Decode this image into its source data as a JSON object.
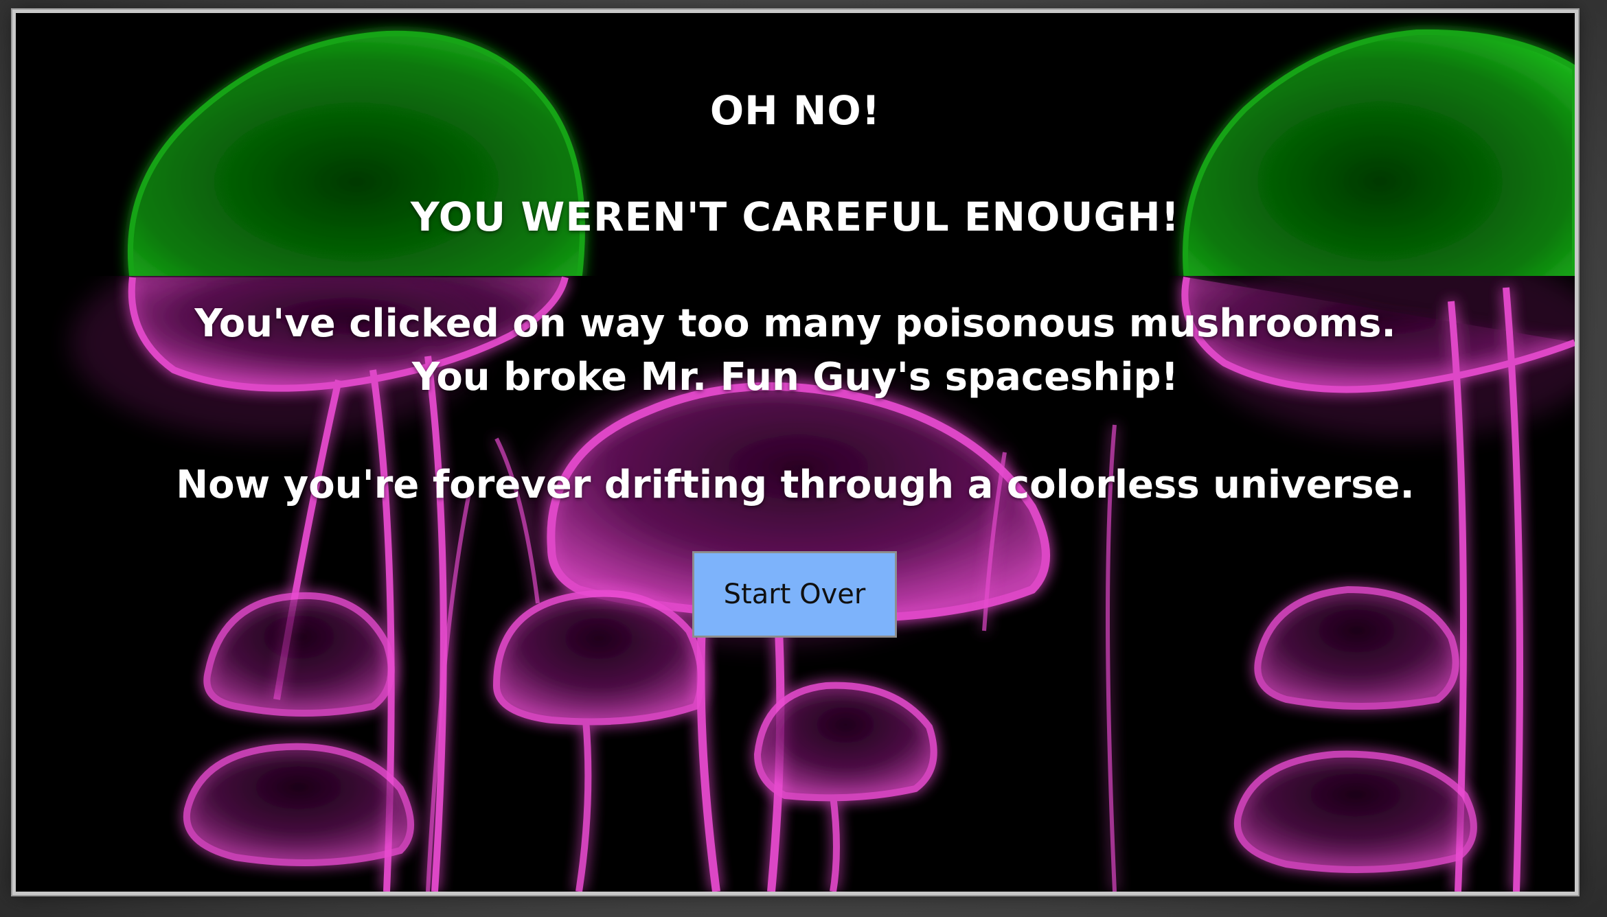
{
  "window": {
    "top_peek_text": ""
  },
  "game_over": {
    "headline": "OH NO!",
    "subheadline": "YOU WEREN'T CAREFUL ENOUGH!",
    "message_line_1": "You've clicked on way too many poisonous mushrooms.",
    "message_line_2": "You broke Mr. Fun Guy's spaceship!",
    "message_line_3": "Now you're forever drifting through a colorless universe.",
    "start_over_label": "Start Over"
  },
  "colors": {
    "background_black": "#000000",
    "mushroom_green": "#0a7a0a",
    "mushroom_magenta": "#e23ec8",
    "button_blue": "#7db3fb",
    "frame_border": "#c9c9c9"
  },
  "icons": {
    "background_art": "neon-mushroom-illustration"
  }
}
